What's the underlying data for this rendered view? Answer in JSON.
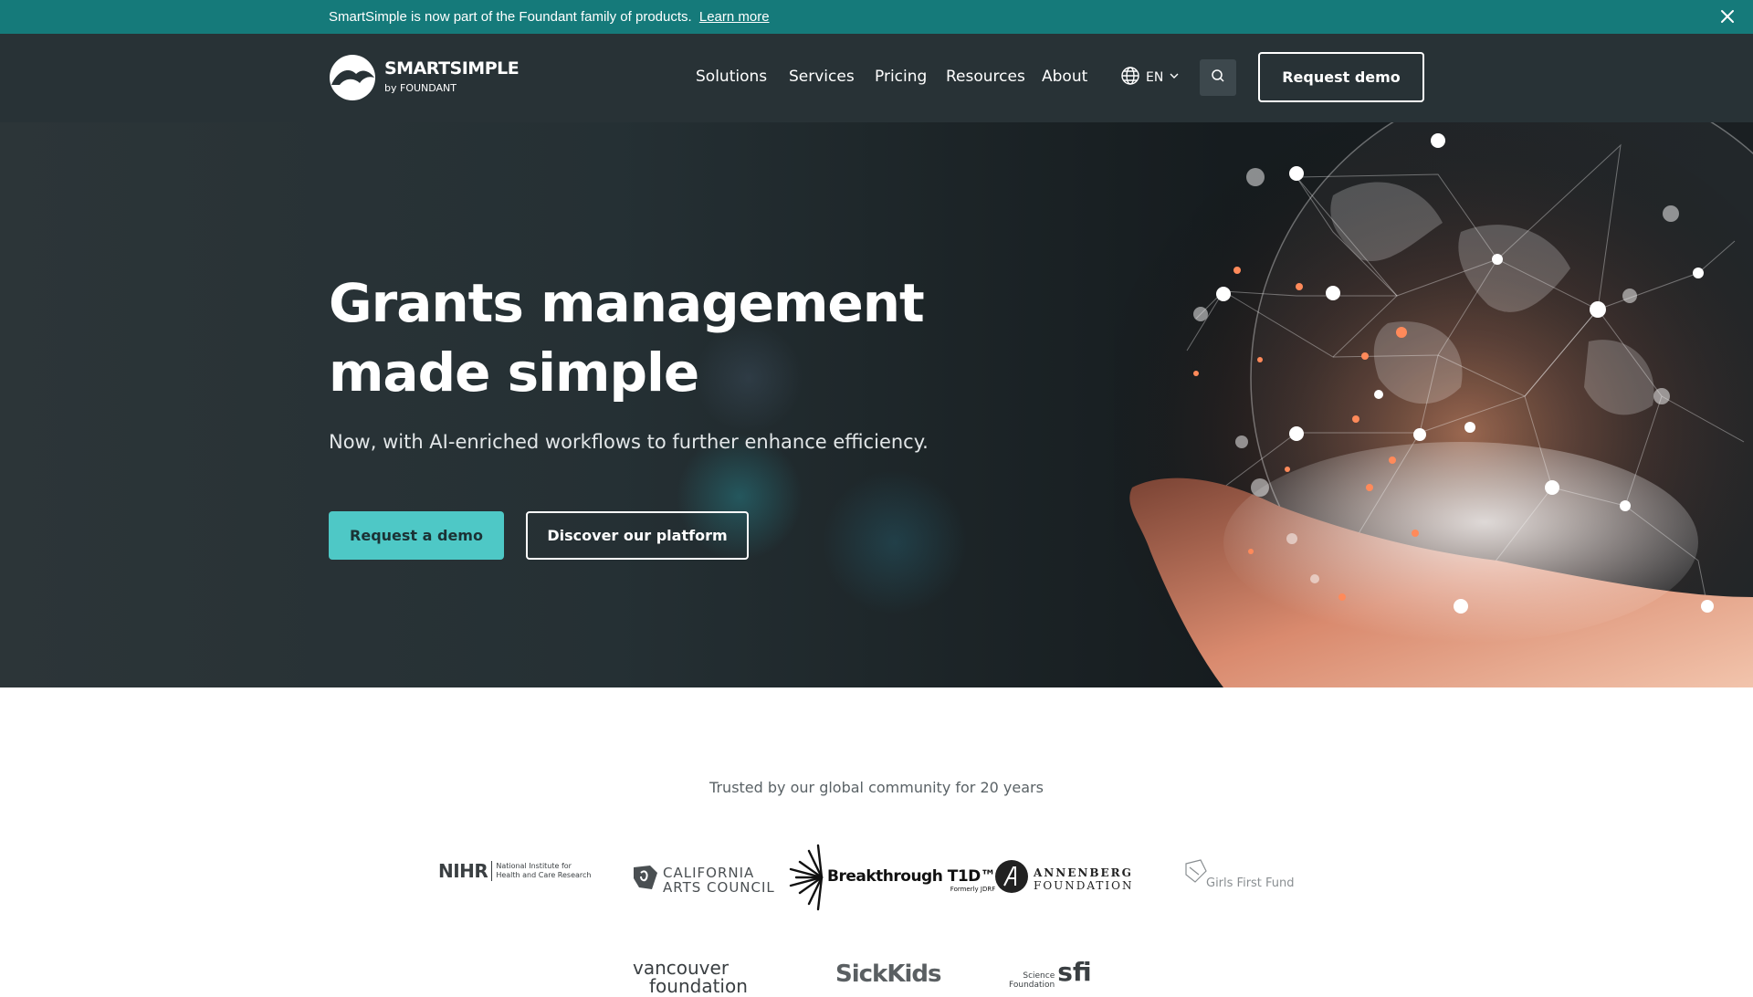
{
  "announcement": {
    "text": "SmartSimple is now part of the Foundant family of products.",
    "link": "Learn more",
    "close_icon": "close-icon"
  },
  "header": {
    "brand": "SMARTSIMPLE",
    "brand_sub": "by FOUNDANT",
    "nav": [
      "Solutions",
      "Services",
      "Pricing",
      "Resources",
      "About"
    ],
    "language": "EN",
    "language_icon": "globe-icon",
    "search_icon": "search-icon",
    "cta": "Request demo"
  },
  "hero": {
    "title_line1": "Grants management",
    "title_line2": "made simple",
    "subtitle": "Now, with AI-enriched workflows to further enhance efficiency.",
    "primary_cta": "Request a demo",
    "secondary_cta": "Discover our platform"
  },
  "trusted": {
    "heading": "Trusted by our global community for 20 years",
    "logos": [
      {
        "name": "NIHR",
        "sub1": "National Institute for",
        "sub2": "Health and Care Research"
      },
      {
        "name_line1": "CALIFORNIA",
        "name_line2": "ARTS COUNCIL"
      },
      {
        "name": "Breakthrough T1D™",
        "sub": "Formerly JDRF"
      },
      {
        "name_line1": "ANNENBERG",
        "name_line2": "FOUNDATION"
      },
      {
        "name": "Girls First Fund"
      },
      {
        "name_line1": "vancouver",
        "name_line2": "foundation"
      },
      {
        "name": "SickKids"
      },
      {
        "name": "Science",
        "name2": "Foundation",
        "mark": "sfi"
      }
    ]
  },
  "colors": {
    "announce_bg": "#157a7a",
    "header_bg": "#283236",
    "accent": "#4ec8c6"
  }
}
